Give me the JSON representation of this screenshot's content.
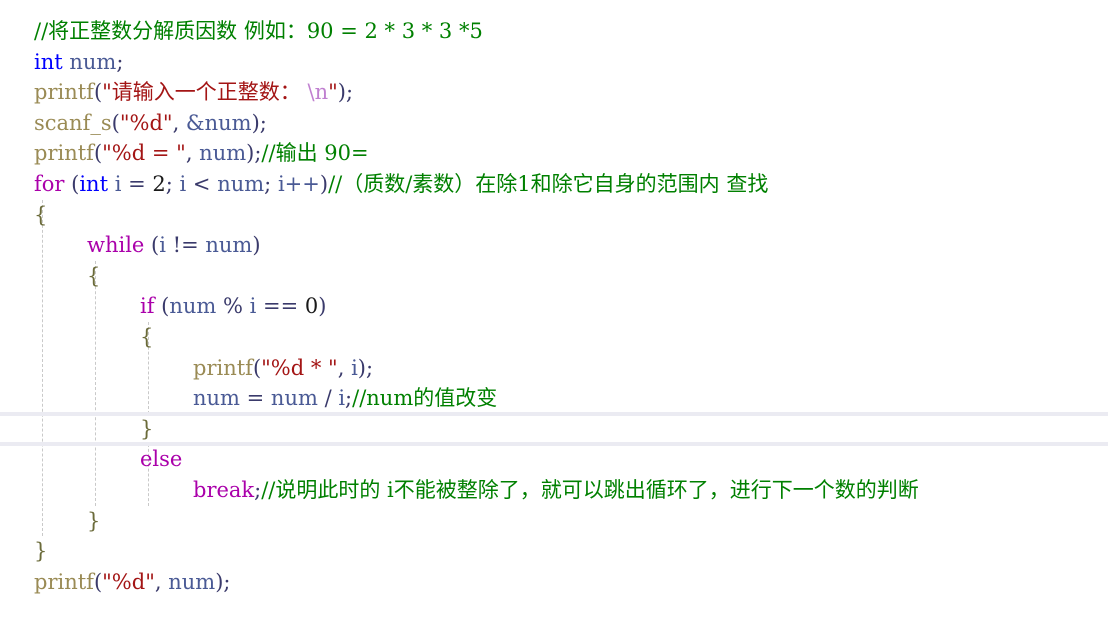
{
  "editor": {
    "language": "c",
    "theme": "light",
    "colors": {
      "background": "#ffffff",
      "comment": "#008000",
      "keyword": "#0000ff",
      "control_keyword": "#aa00aa",
      "function": "#9a8b55",
      "string": "#a31515",
      "escape": "#c080d0",
      "variable": "#4a5a95",
      "number": "#1a1a1a",
      "indent_guide": "#c9c9c9",
      "current_line_highlight": "#ebebf2"
    },
    "indent_guides_x": [
      42,
      95,
      148,
      201
    ],
    "highlighted_line_index": 13
  },
  "code_lines": [
    {
      "indent": 0,
      "tokens": [
        {
          "t": "//将正整数分解质因数 例如：90 = 2 * 3 * 3 *5",
          "c": "comment"
        }
      ]
    },
    {
      "indent": 0,
      "tokens": [
        {
          "t": "int",
          "c": "key"
        },
        {
          "t": " ",
          "c": "plain"
        },
        {
          "t": "num",
          "c": "var"
        },
        {
          "t": ";",
          "c": "punct"
        }
      ]
    },
    {
      "indent": 0,
      "tokens": [
        {
          "t": "printf",
          "c": "func"
        },
        {
          "t": "(",
          "c": "punct"
        },
        {
          "t": "\"请输入一个正整数：",
          "c": "str"
        },
        {
          "t": " \\n",
          "c": "esc"
        },
        {
          "t": "\"",
          "c": "str"
        },
        {
          "t": ");",
          "c": "punct"
        }
      ]
    },
    {
      "indent": 0,
      "tokens": [
        {
          "t": "scanf_s",
          "c": "func"
        },
        {
          "t": "(",
          "c": "punct"
        },
        {
          "t": "\"%d\"",
          "c": "str"
        },
        {
          "t": ", ",
          "c": "punct"
        },
        {
          "t": "&num",
          "c": "var"
        },
        {
          "t": ");",
          "c": "punct"
        }
      ]
    },
    {
      "indent": 0,
      "tokens": [
        {
          "t": "printf",
          "c": "func"
        },
        {
          "t": "(",
          "c": "punct"
        },
        {
          "t": "\"%d = \"",
          "c": "str"
        },
        {
          "t": ", ",
          "c": "punct"
        },
        {
          "t": "num",
          "c": "var"
        },
        {
          "t": ");",
          "c": "punct"
        },
        {
          "t": "//输出 90=",
          "c": "comment"
        }
      ]
    },
    {
      "indent": 0,
      "tokens": [
        {
          "t": "for",
          "c": "ctrl"
        },
        {
          "t": " (",
          "c": "punct"
        },
        {
          "t": "int",
          "c": "key"
        },
        {
          "t": " ",
          "c": "plain"
        },
        {
          "t": "i",
          "c": "var"
        },
        {
          "t": " = ",
          "c": "punct"
        },
        {
          "t": "2",
          "c": "num"
        },
        {
          "t": "; ",
          "c": "punct"
        },
        {
          "t": "i",
          "c": "var"
        },
        {
          "t": " < ",
          "c": "punct"
        },
        {
          "t": "num",
          "c": "var"
        },
        {
          "t": "; ",
          "c": "punct"
        },
        {
          "t": "i++",
          "c": "var"
        },
        {
          "t": ")",
          "c": "punct"
        },
        {
          "t": "//（质数/素数）在除1和除它自身的范围内 查找",
          "c": "comment"
        }
      ]
    },
    {
      "indent": 0,
      "tokens": [
        {
          "t": "{",
          "c": "brace"
        }
      ]
    },
    {
      "indent": 1,
      "tokens": [
        {
          "t": "while",
          "c": "ctrl"
        },
        {
          "t": " (",
          "c": "punct"
        },
        {
          "t": "i",
          "c": "var"
        },
        {
          "t": " != ",
          "c": "punct"
        },
        {
          "t": "num",
          "c": "var"
        },
        {
          "t": ")",
          "c": "punct"
        }
      ]
    },
    {
      "indent": 1,
      "tokens": [
        {
          "t": "{",
          "c": "brace"
        }
      ]
    },
    {
      "indent": 2,
      "tokens": [
        {
          "t": "if",
          "c": "ctrl"
        },
        {
          "t": " (",
          "c": "punct"
        },
        {
          "t": "num",
          "c": "var"
        },
        {
          "t": " % ",
          "c": "punct"
        },
        {
          "t": "i",
          "c": "var"
        },
        {
          "t": " == ",
          "c": "punct"
        },
        {
          "t": "0",
          "c": "num"
        },
        {
          "t": ")",
          "c": "punct"
        }
      ]
    },
    {
      "indent": 2,
      "tokens": [
        {
          "t": "{",
          "c": "brace"
        }
      ]
    },
    {
      "indent": 3,
      "tokens": [
        {
          "t": "printf",
          "c": "func"
        },
        {
          "t": "(",
          "c": "punct"
        },
        {
          "t": "\"%d * \"",
          "c": "str"
        },
        {
          "t": ", ",
          "c": "punct"
        },
        {
          "t": "i",
          "c": "var"
        },
        {
          "t": ");",
          "c": "punct"
        }
      ]
    },
    {
      "indent": 3,
      "tokens": [
        {
          "t": "num",
          "c": "var"
        },
        {
          "t": " = ",
          "c": "punct"
        },
        {
          "t": "num",
          "c": "var"
        },
        {
          "t": " / ",
          "c": "punct"
        },
        {
          "t": "i",
          "c": "var"
        },
        {
          "t": ";",
          "c": "punct"
        },
        {
          "t": "//num的值改变",
          "c": "comment"
        }
      ]
    },
    {
      "indent": 2,
      "tokens": [
        {
          "t": "}",
          "c": "brace"
        }
      ]
    },
    {
      "indent": 2,
      "tokens": [
        {
          "t": "else",
          "c": "ctrl"
        }
      ]
    },
    {
      "indent": 3,
      "tokens": [
        {
          "t": "break",
          "c": "ctrl"
        },
        {
          "t": ";",
          "c": "punct"
        },
        {
          "t": "//说明此时的 i不能被整除了，就可以跳出循环了，进行下一个数的判断",
          "c": "comment"
        }
      ]
    },
    {
      "indent": 1,
      "tokens": [
        {
          "t": "}",
          "c": "brace"
        }
      ]
    },
    {
      "indent": 0,
      "tokens": [
        {
          "t": "}",
          "c": "brace"
        }
      ]
    },
    {
      "indent": 0,
      "tokens": [
        {
          "t": "printf",
          "c": "func"
        },
        {
          "t": "(",
          "c": "punct"
        },
        {
          "t": "\"%d\"",
          "c": "str"
        },
        {
          "t": ", ",
          "c": "punct"
        },
        {
          "t": "num",
          "c": "var"
        },
        {
          "t": ");",
          "c": "punct"
        }
      ]
    }
  ]
}
